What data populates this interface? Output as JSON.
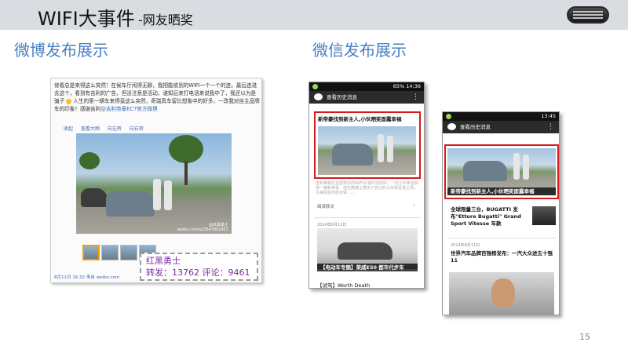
{
  "header": {
    "title": "WIFI大事件",
    "subtitle": "-网友晒奖"
  },
  "sections": {
    "weibo_title": "微博发布展示",
    "wechat_title": "微信发布展示"
  },
  "weibo": {
    "text_part1": "修看总是来得这么突然！在候车厅闲得无聊，我把能收到的WIFI一个一个的连。最后连进去这个，看到有吉利的广告，但没注意是活动，谁知后来打电话来说我中了，我还以为是骗子",
    "text_part2": "人生的第一辆车来得竟这么突然，奇瑞真车留比想象中的好多，一改我对自主品牌车的印象！感谢吉利",
    "text_link": "@吉利帝豪EC7官方微博",
    "actions": [
      "收起",
      "查看大图",
      "向左转",
      "向右转"
    ],
    "photo_caption": "@红黑勇士",
    "photo_url": "weibo.com/u/3547802451",
    "footer": "8月11日 16:32  来自 weibo.com"
  },
  "callout": {
    "name": "红黑勇士",
    "stats": "转发：13762  评论：9461"
  },
  "phone1": {
    "time": "14:36",
    "battery": "65%",
    "app_title": "查看历史消息",
    "more_icon": "⋮",
    "headline": "新帝豪找到新主人,小伙晒奖面露幸福",
    "desc": "吉利帝豪在全国举办的WIFI大事件活动中，一位小伙幸运获得一辆新帝豪，他在微博上晒出了自己的大奖和喜悦之情，引来网友纷纷点赞……",
    "read_more": "阅读原文",
    "date2": "2014年8月11日",
    "caption2": "【电动车专题】荣威E50 都市代步车",
    "caption3": "【试驾】Worth Death"
  },
  "phone2": {
    "time": "13:45",
    "battery": "",
    "app_title": "查看历史消息",
    "more_icon": "⋮",
    "headline": "新帝豪找到新主人,小伙晒奖面露幸福",
    "item2": "全球限量三台，BUGATTI 发布\"Ettore Bugatti\" Grand Sport Vitesse 车款",
    "date2": "2014年8月11日",
    "item3": "世界汽车品牌百强榜发布：一汽大众进五十强 11"
  },
  "footer": {
    "page_number": "15"
  },
  "colors": {
    "banner_bg": "#d9dde1",
    "section_title": "#4a7fc2",
    "highlight": "#d6191c",
    "callout_text": "#7a2a9e"
  }
}
